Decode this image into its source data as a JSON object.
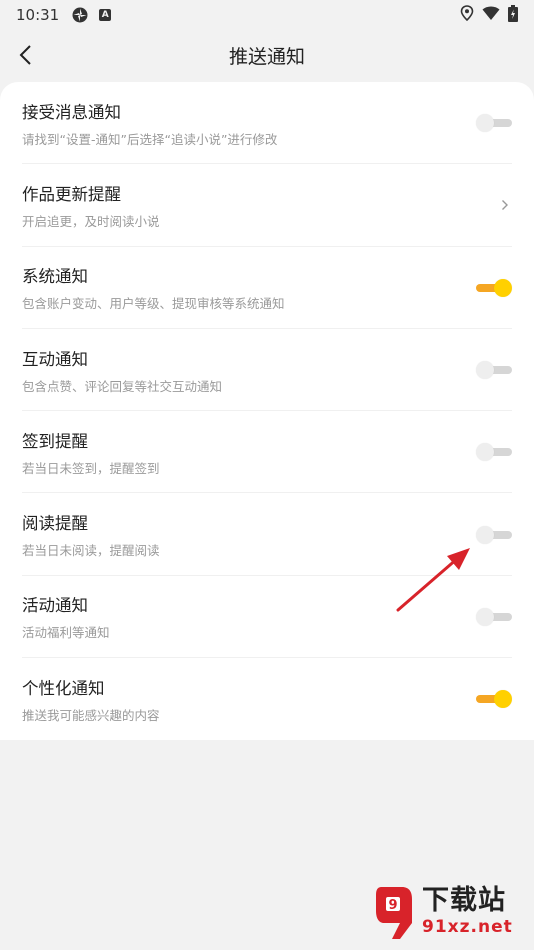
{
  "status_bar": {
    "time": "10:31",
    "left_icons": [
      "sync-icon",
      "app-a-icon"
    ],
    "app_badge": "A",
    "right_icons": [
      "location-icon",
      "wifi-icon",
      "battery-icon"
    ]
  },
  "header": {
    "title": "推送通知",
    "back_icon": "chevron-left-icon"
  },
  "colors": {
    "toggle_on_track": "#f5a623",
    "toggle_on_knob": "#ffd000",
    "toggle_off_track": "#d6d6d6",
    "toggle_off_knob": "#eeeeee",
    "annotation_arrow": "#d8232a"
  },
  "settings": [
    {
      "title": "接受消息通知",
      "subtitle": "请找到“设置-通知”后选择“追读小说”进行修改",
      "control": "toggle",
      "on": false
    },
    {
      "title": "作品更新提醒",
      "subtitle": "开启追更，及时阅读小说",
      "control": "chevron",
      "on": false
    },
    {
      "title": "系统通知",
      "subtitle": "包含账户变动、用户等级、提现审核等系统通知",
      "control": "toggle",
      "on": true
    },
    {
      "title": "互动通知",
      "subtitle": "包含点赞、评论回复等社交互动通知",
      "control": "toggle",
      "on": false
    },
    {
      "title": "签到提醒",
      "subtitle": "若当日未签到，提醒签到",
      "control": "toggle",
      "on": false
    },
    {
      "title": "阅读提醒",
      "subtitle": "若当日未阅读，提醒阅读",
      "control": "toggle",
      "on": false
    },
    {
      "title": "活动通知",
      "subtitle": "活动福利等通知",
      "control": "toggle",
      "on": false
    },
    {
      "title": "个性化通知",
      "subtitle": "推送我可能感兴趣的内容",
      "control": "toggle",
      "on": true
    }
  ],
  "watermark": {
    "logo": "9",
    "big_text": "下载站",
    "small_text": "91xz.net"
  }
}
